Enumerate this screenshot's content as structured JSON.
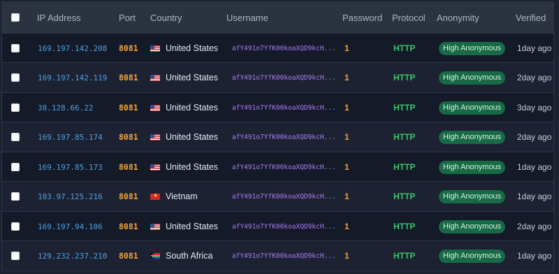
{
  "header": {
    "ip": "IP Address",
    "port": "Port",
    "country": "Country",
    "username": "Username",
    "password": "Password",
    "protocol": "Protocol",
    "anonymity": "Anonymity",
    "verified": "Verified"
  },
  "rows": [
    {
      "ip": "169.197.142.208",
      "port": "8081",
      "flag": "us-flag-icon",
      "country": "United States",
      "username": "afY491o7YfK00koaXQD9kcH...",
      "password": "1",
      "protocol": "HTTP",
      "anonymity": "High Anonymous",
      "verified": "1day ago"
    },
    {
      "ip": "169.197.142.119",
      "port": "8081",
      "flag": "us-flag-icon",
      "country": "United States",
      "username": "afY491o7YfK00koaXQD9kcH...",
      "password": "1",
      "protocol": "HTTP",
      "anonymity": "High Anonymous",
      "verified": "2day ago"
    },
    {
      "ip": "38.128.66.22",
      "port": "8081",
      "flag": "us-flag-icon",
      "country": "United States",
      "username": "afY491o7YfK00koaXQD9kcH...",
      "password": "1",
      "protocol": "HTTP",
      "anonymity": "High Anonymous",
      "verified": "3day ago"
    },
    {
      "ip": "169.197.85.174",
      "port": "8081",
      "flag": "us-flag-icon",
      "country": "United States",
      "username": "afY491o7YfK00koaXQD9kcH...",
      "password": "1",
      "protocol": "HTTP",
      "anonymity": "High Anonymous",
      "verified": "2day ago"
    },
    {
      "ip": "169.197.85.173",
      "port": "8081",
      "flag": "us-flag-icon",
      "country": "United States",
      "username": "afY491o7YfK00koaXQD9kcH...",
      "password": "1",
      "protocol": "HTTP",
      "anonymity": "High Anonymous",
      "verified": "1day ago"
    },
    {
      "ip": "103.97.125.216",
      "port": "8081",
      "flag": "vn-flag-icon",
      "country": "Vietnam",
      "username": "afY491o7YfK00koaXQD9kcH...",
      "password": "1",
      "protocol": "HTTP",
      "anonymity": "High Anonymous",
      "verified": "1day ago"
    },
    {
      "ip": "169.197.94.106",
      "port": "8081",
      "flag": "us-flag-icon",
      "country": "United States",
      "username": "afY491o7YfK00koaXQD9kcH...",
      "password": "1",
      "protocol": "HTTP",
      "anonymity": "High Anonymous",
      "verified": "2day ago"
    },
    {
      "ip": "129.232.237.210",
      "port": "8081",
      "flag": "za-flag-icon",
      "country": "South Africa",
      "username": "afY491o7YfK00koaXQD9kcH...",
      "password": "1",
      "protocol": "HTTP",
      "anonymity": "High Anonymous",
      "verified": "1day ago"
    }
  ],
  "colors": {
    "ip": "#4f9fe0",
    "port": "#f2a43a",
    "username": "#a97df0",
    "protocol": "#3ec46d",
    "badge_bg": "#176a45",
    "header_bg": "#2b3240"
  }
}
